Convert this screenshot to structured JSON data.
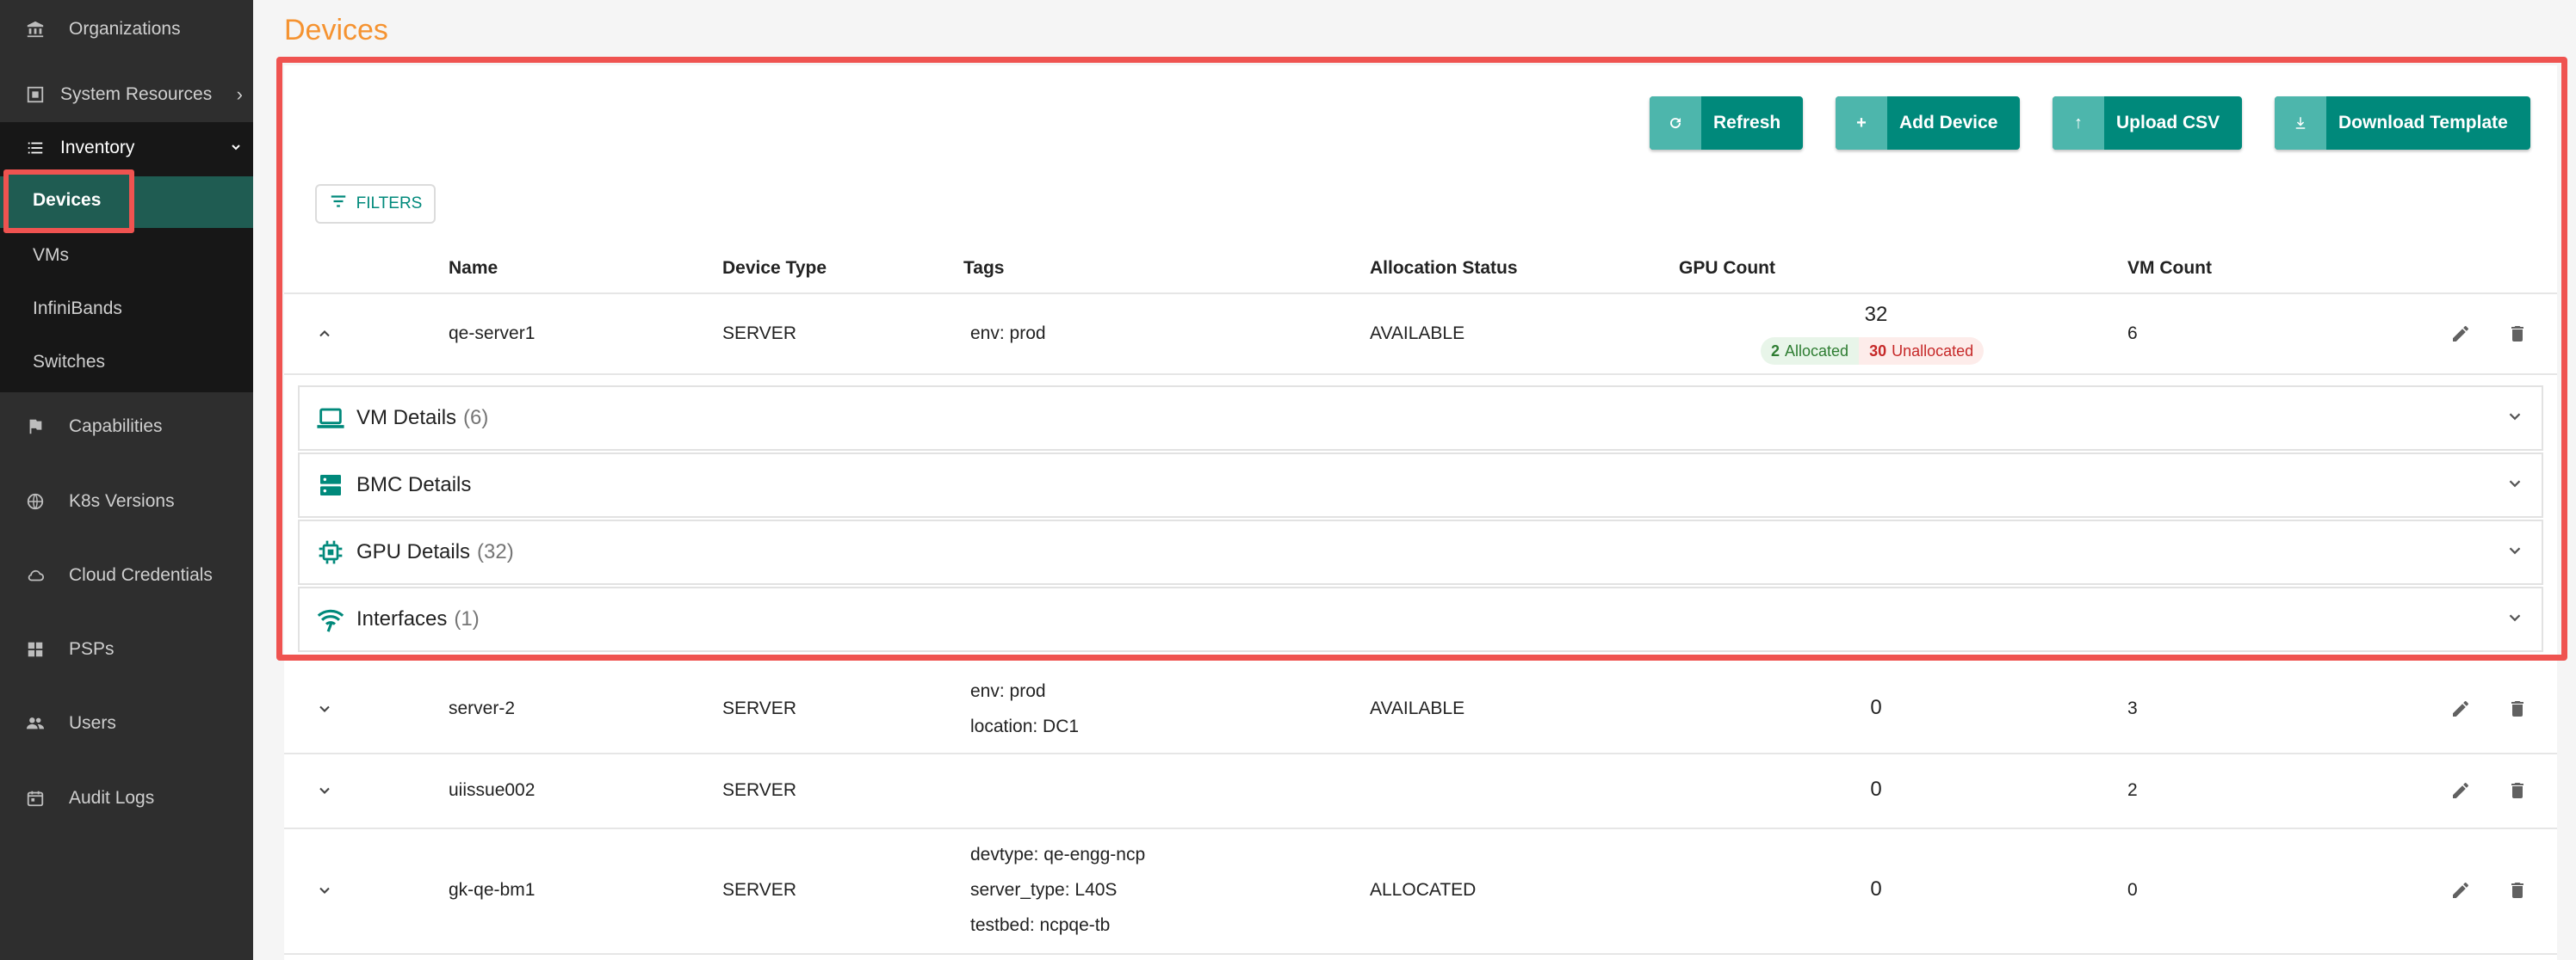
{
  "sidebar": {
    "items": [
      {
        "label": "Organizations",
        "icon": "bank-icon"
      },
      {
        "label": "System Resources",
        "icon": "resources-icon"
      },
      {
        "label": "Inventory",
        "icon": "list-icon"
      },
      {
        "label": "Capabilities",
        "icon": "flag-icon"
      },
      {
        "label": "K8s Versions",
        "icon": "globe-icon"
      },
      {
        "label": "Cloud Credentials",
        "icon": "cloud-icon"
      },
      {
        "label": "PSPs",
        "icon": "grid-icon"
      },
      {
        "label": "Users",
        "icon": "users-icon"
      },
      {
        "label": "Audit Logs",
        "icon": "calendar-icon"
      }
    ],
    "inventory_sub": [
      "Devices",
      "VMs",
      "InfiniBands",
      "Switches"
    ]
  },
  "page": {
    "title": "Devices"
  },
  "toolbar": {
    "refresh": "Refresh",
    "add_device": "Add Device",
    "upload_csv": "Upload CSV",
    "download_template": "Download Template",
    "filters": "FILTERS"
  },
  "table": {
    "columns": [
      "Name",
      "Device Type",
      "Tags",
      "Allocation Status",
      "GPU Count",
      "VM Count"
    ],
    "rows": [
      {
        "name": "qe-server1",
        "type": "SERVER",
        "tags": [
          "env: prod"
        ],
        "status": "AVAILABLE",
        "gpu": "32",
        "vm": "6",
        "gpu_allocated": "2",
        "gpu_allocated_label": "Allocated",
        "gpu_unallocated": "30",
        "gpu_unallocated_label": "Unallocated"
      },
      {
        "name": "server-2",
        "type": "SERVER",
        "tags": [
          "env: prod",
          "location: DC1"
        ],
        "status": "AVAILABLE",
        "gpu": "0",
        "vm": "3"
      },
      {
        "name": "uiissue002",
        "type": "SERVER",
        "tags": [],
        "status": "",
        "gpu": "0",
        "vm": "2"
      },
      {
        "name": "gk-qe-bm1",
        "type": "SERVER",
        "tags": [
          "devtype: qe-engg-ncp",
          "server_type: L40S",
          "testbed: ncpqe-tb"
        ],
        "status": "ALLOCATED",
        "gpu": "0",
        "vm": "0"
      }
    ]
  },
  "details": [
    {
      "title": "VM Details",
      "count": "(6)",
      "icon": "laptop-icon"
    },
    {
      "title": "BMC Details",
      "count": "",
      "icon": "server-icon"
    },
    {
      "title": "GPU Details",
      "count": "(32)",
      "icon": "chip-icon"
    },
    {
      "title": "Interfaces",
      "count": "(1)",
      "icon": "wifi-icon"
    }
  ],
  "colors": {
    "accent": "#00897b",
    "title": "#f59331",
    "highlight": "#ef5350",
    "sidebar": "#2e2e2e"
  }
}
